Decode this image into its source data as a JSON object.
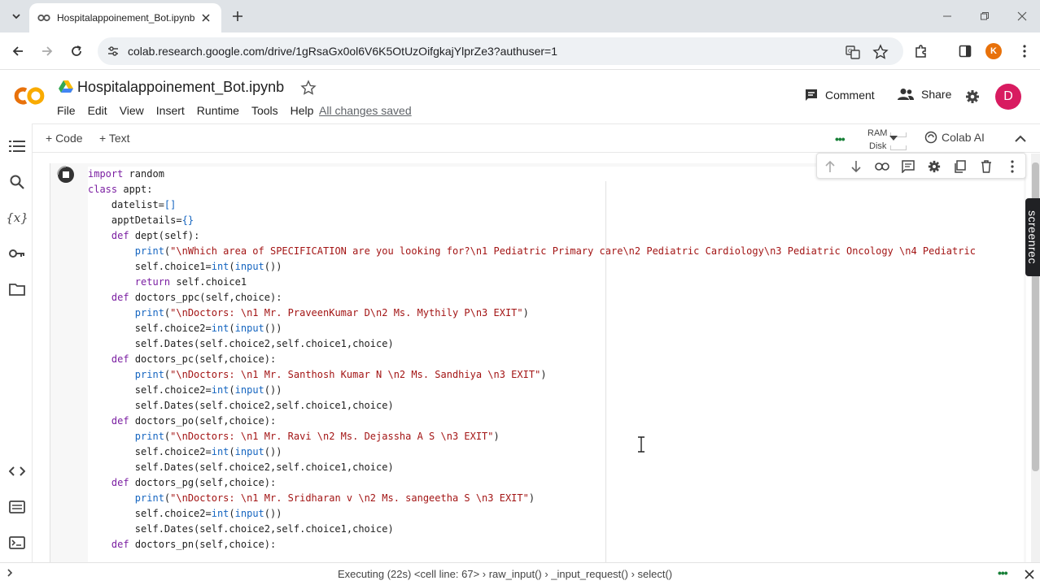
{
  "browser": {
    "tab_title": "Hospitalappoinement_Bot.ipynb",
    "url": "colab.research.google.com/drive/1gRsaGx0ol6V6K5OtUzOifgkajYlprZe3?authuser=1",
    "profile_initial": "K"
  },
  "colab": {
    "notebook_title": "Hospitalappoinement_Bot.ipynb",
    "menu": [
      "File",
      "Edit",
      "View",
      "Insert",
      "Runtime",
      "Tools",
      "Help"
    ],
    "saved_status": "All changes saved",
    "comment_label": "Comment",
    "share_label": "Share",
    "user_initial": "D"
  },
  "toolbar": {
    "add_code": "+ Code",
    "add_text": "+ Text",
    "ram_label": "RAM",
    "disk_label": "Disk",
    "colab_ai": "Colab AI"
  },
  "cell": {
    "code_lines": [
      "import random",
      "class appt:",
      "    datelist=[]",
      "    apptDetails={}",
      "    def dept(self):",
      "        print(\"\\nWhich area of SPECIFICATION are you looking for?\\n1 Pediatric Primary care\\n2 Pediatric Cardiology\\n3 Pediatric Oncology \\n4 Pediatric",
      "        self.choice1=int(input())",
      "        return self.choice1",
      "    def doctors_ppc(self,choice):",
      "        print(\"\\nDoctors: \\n1 Mr. PraveenKumar D\\n2 Ms. Mythily P\\n3 EXIT\")",
      "        self.choice2=int(input())",
      "        self.Dates(self.choice2,self.choice1,choice)",
      "    def doctors_pc(self,choice):",
      "        print(\"\\nDoctors: \\n1 Mr. Santhosh Kumar N \\n2 Ms. Sandhiya \\n3 EXIT\")",
      "        self.choice2=int(input())",
      "        self.Dates(self.choice2,self.choice1,choice)",
      "    def doctors_po(self,choice):",
      "        print(\"\\nDoctors: \\n1 Mr. Ravi \\n2 Ms. Dejassha A S \\n3 EXIT\")",
      "        self.choice2=int(input())",
      "        self.Dates(self.choice2,self.choice1,choice)",
      "    def doctors_pg(self,choice):",
      "        print(\"\\nDoctors: \\n1 Mr. Sridharan v \\n2 Ms. sangeetha S \\n3 EXIT\")",
      "        self.choice2=int(input())",
      "        self.Dates(self.choice2,self.choice1,choice)",
      "    def doctors_pn(self,choice):"
    ]
  },
  "status": {
    "text": "Executing (22s) <cell line: 67> › raw_input() › _input_request() › select()"
  },
  "overlay": {
    "screenrec_label": "screenrec"
  }
}
